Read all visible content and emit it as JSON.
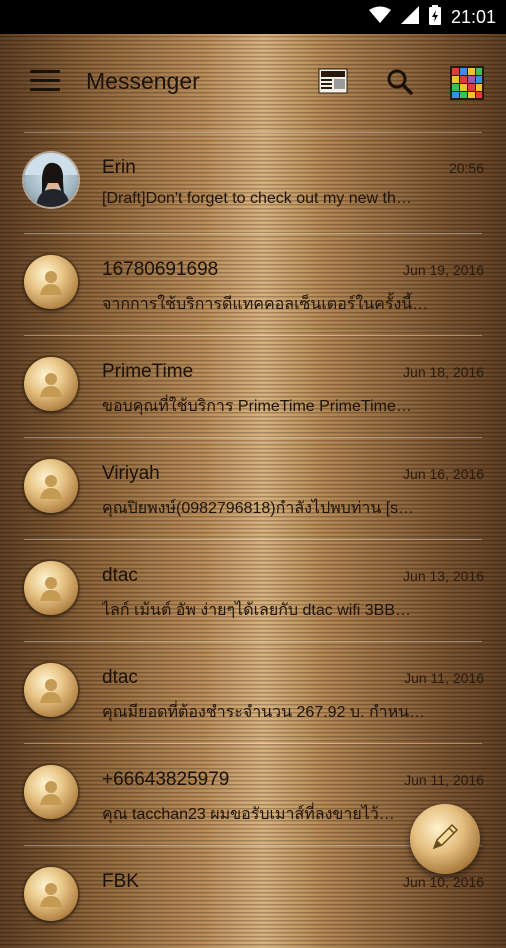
{
  "status_bar": {
    "time": "21:01",
    "icons": [
      "wifi-icon",
      "signal-icon",
      "battery-charging-icon"
    ]
  },
  "app_bar": {
    "title": "Messenger",
    "icons": [
      "menu-icon",
      "news-icon",
      "search-icon",
      "apps-icon"
    ]
  },
  "conversations": [
    {
      "name": "Erin",
      "date": "20:56",
      "snippet": "[Draft]Don't forget to check out my new th…",
      "avatar": "photo"
    },
    {
      "name": "16780691698",
      "date": "Jun 19, 2016",
      "snippet": "จากการใช้บริการดีแทคคอลเซ็นเตอร์ในครั้งนี้…",
      "avatar": "default-contact-icon"
    },
    {
      "name": "PrimeTime",
      "date": "Jun 18, 2016",
      "snippet": "ขอบคุณที่ใช้บริการ PrimeTime PrimeTime…",
      "avatar": "default-contact-icon"
    },
    {
      "name": "Viriyah",
      "date": "Jun 16, 2016",
      "snippet": "คุณปิยพงษ์(0982796818)กำลังไปพบท่าน [s…",
      "avatar": "default-contact-icon"
    },
    {
      "name": "dtac",
      "date": "Jun 13, 2016",
      "snippet": "ไลก์ เม้นต์ อัพ ง่ายๆได้เลยกับ dtac wifi 3BB…",
      "avatar": "default-contact-icon"
    },
    {
      "name": "dtac",
      "date": "Jun 11, 2016",
      "snippet": "คุณมียอดที่ต้องชำระจำนวน 267.92 บ. กำหน…",
      "avatar": "default-contact-icon"
    },
    {
      "name": "+66643825979",
      "date": "Jun 11, 2016",
      "snippet": "คุณ tacchan23 ผมขอรับเมาส์ที่ลงขายไว้…",
      "avatar": "default-contact-icon"
    },
    {
      "name": "FBK",
      "date": "Jun 10, 2016",
      "snippet": "",
      "avatar": "default-contact-icon"
    }
  ],
  "fab": {
    "icon": "pencil-compose-icon"
  }
}
